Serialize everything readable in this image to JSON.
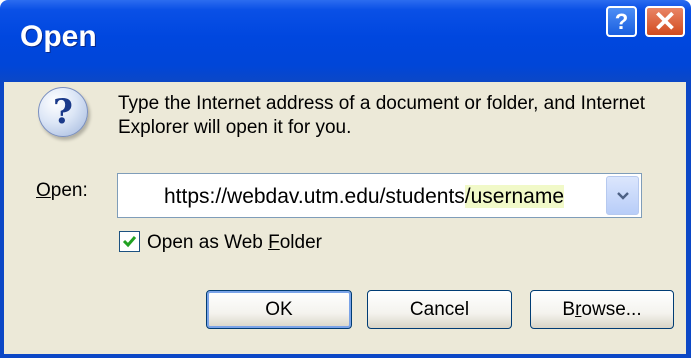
{
  "dialog": {
    "title": "Open",
    "help_glyph": "?",
    "close_glyph": "✕",
    "icon": "question-icon",
    "description": "Type the Internet address of a document or folder, and Internet Explorer will open it for you.",
    "open_label_accel": "O",
    "open_label_rest": "pen:",
    "address_prefix": "https://webdav.utm.edu/students",
    "address_highlight": "/username",
    "web_folder_checked": true,
    "web_folder_pre": "Open as Web ",
    "web_folder_accel": "F",
    "web_folder_post": "older",
    "ok_label": "OK",
    "cancel_label": "Cancel",
    "browse_pre": "B",
    "browse_accel": "r",
    "browse_post": "owse...",
    "colors": {
      "titlebar": "#0046d8",
      "body": "#ece9d8",
      "highlight": "#f1f9c8",
      "close": "#d24b1f"
    }
  }
}
